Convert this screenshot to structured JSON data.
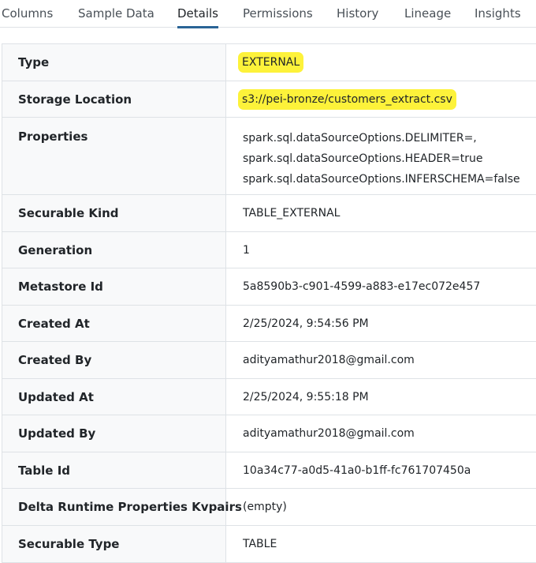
{
  "tabs": [
    {
      "label": "Columns"
    },
    {
      "label": "Sample Data"
    },
    {
      "label": "Details",
      "active": true
    },
    {
      "label": "Permissions"
    },
    {
      "label": "History"
    },
    {
      "label": "Lineage"
    },
    {
      "label": "Insights"
    }
  ],
  "details": {
    "type": {
      "label": "Type",
      "value": "EXTERNAL"
    },
    "storage_location": {
      "label": "Storage Location",
      "value": "s3://pei-bronze/customers_extract.csv"
    },
    "properties": {
      "label": "Properties",
      "values": [
        "spark.sql.dataSourceOptions.DELIMITER=,",
        "spark.sql.dataSourceOptions.HEADER=true",
        "spark.sql.dataSourceOptions.INFERSCHEMA=false"
      ]
    },
    "securable_kind": {
      "label": "Securable Kind",
      "value": "TABLE_EXTERNAL"
    },
    "generation": {
      "label": "Generation",
      "value": "1"
    },
    "metastore_id": {
      "label": "Metastore Id",
      "value": "5a8590b3-c901-4599-a883-e17ec072e457"
    },
    "created_at": {
      "label": "Created At",
      "value": "2/25/2024, 9:54:56 PM"
    },
    "created_by": {
      "label": "Created By",
      "value": "adityamathur2018@gmail.com"
    },
    "updated_at": {
      "label": "Updated At",
      "value": "2/25/2024, 9:55:18 PM"
    },
    "updated_by": {
      "label": "Updated By",
      "value": "adityamathur2018@gmail.com"
    },
    "table_id": {
      "label": "Table Id",
      "value": "10a34c77-a0d5-41a0-b1ff-fc761707450a"
    },
    "delta_runtime_properties": {
      "label": "Delta Runtime Properties Kvpairs",
      "value": "(empty)"
    },
    "securable_type": {
      "label": "Securable Type",
      "value": "TABLE"
    }
  },
  "colors": {
    "highlight": "#fdf23a",
    "active_tab_underline": "#2a6496"
  }
}
